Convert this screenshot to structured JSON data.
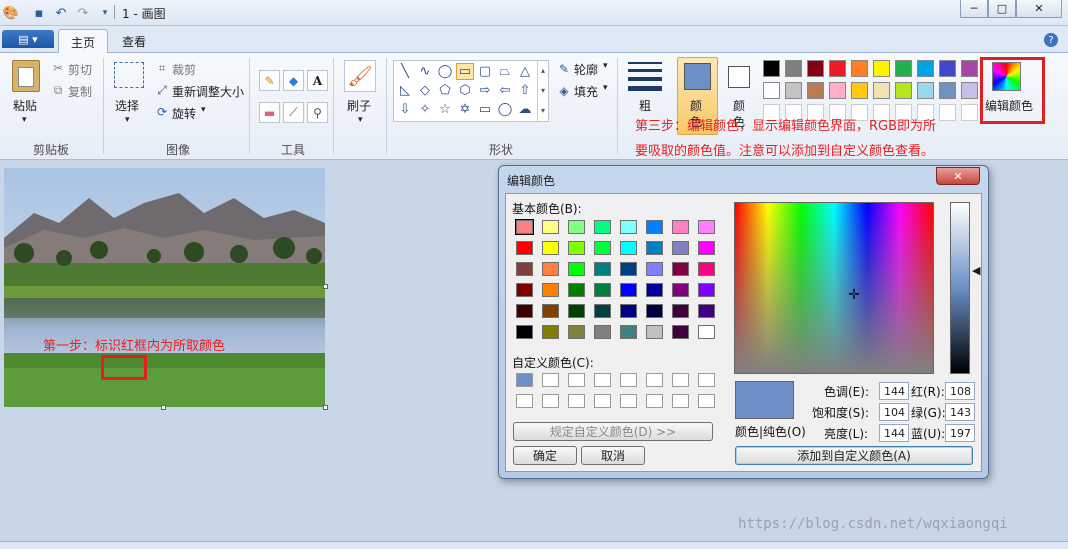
{
  "window": {
    "title": "1 - 画图",
    "min": "─",
    "max": "□",
    "close": "✕"
  },
  "tabs": {
    "file": "▤ ▾",
    "home": "主页",
    "view": "查看",
    "help": "?"
  },
  "clipboard": {
    "paste": "粘贴",
    "cut": "剪切",
    "copy": "复制",
    "label": "剪贴板"
  },
  "image_group": {
    "select": "选择",
    "crop": "裁剪",
    "resize": "重新调整大小",
    "rotate": "旋转",
    "label": "图像"
  },
  "tools_group": {
    "label": "工具",
    "brush": "刷子"
  },
  "shapes_group": {
    "outline": "轮廓",
    "fill": "填充",
    "label": "形状"
  },
  "size_label": "粗",
  "color1_label": "颜",
  "color1_label2": "色",
  "color2_label": "颜",
  "color2_label2": "色",
  "edit_colors_label": "编辑颜色",
  "palette": [
    "#000000",
    "#7f7f7f",
    "#880015",
    "#ed1c24",
    "#ff7f27",
    "#fff200",
    "#22b14c",
    "#00a2e8",
    "#3f48cc",
    "#a349a4",
    "#ffffff",
    "#c3c3c3",
    "#b97a57",
    "#ffaec9",
    "#ffc90e",
    "#efe4b0",
    "#b5e61d",
    "#99d9ea",
    "#7092be",
    "#c8bfe7"
  ],
  "annotations": {
    "step1": "第一步：标识红框内为所取颜色",
    "step3_line1": "第三步：编辑颜色，显示编辑颜色界面，RGB即为所",
    "step3_line2": "要吸取的颜色值。注意可以添加到自定义颜色查看。"
  },
  "dialog": {
    "title": "编辑颜色",
    "close": "✕",
    "basic_colors_label": "基本颜色(B):",
    "custom_colors_label": "自定义颜色(C):",
    "define_custom_button": "规定自定义颜色(D) >>",
    "ok_button": "确定",
    "cancel_button": "取消",
    "solid_label": "颜色|纯色(O)",
    "add_custom_button": "添加到自定义颜色(A)",
    "hue_label": "色调(E):",
    "hue": "144",
    "sat_label": "饱和度(S):",
    "sat": "104",
    "lum_label": "亮度(L):",
    "lum": "144",
    "red_label": "红(R):",
    "red": "108",
    "green_label": "绿(G):",
    "green": "143",
    "blue_label": "蓝(U):",
    "blue": "197",
    "current_color": "#6c8fc5",
    "basic_colors": [
      "#ff8080",
      "#ffff80",
      "#80ff80",
      "#00ff80",
      "#80ffff",
      "#0080ff",
      "#ff80c0",
      "#ff80ff",
      "#ff0000",
      "#ffff00",
      "#80ff00",
      "#00ff40",
      "#00ffff",
      "#0080c0",
      "#8080c0",
      "#ff00ff",
      "#804040",
      "#ff8040",
      "#00ff00",
      "#008080",
      "#004080",
      "#8080ff",
      "#800040",
      "#ff0080",
      "#800000",
      "#ff8000",
      "#008000",
      "#008040",
      "#0000ff",
      "#0000a0",
      "#800080",
      "#8000ff",
      "#400000",
      "#804000",
      "#004000",
      "#004040",
      "#000080",
      "#000040",
      "#400040",
      "#400080",
      "#000000",
      "#808000",
      "#808040",
      "#808080",
      "#408080",
      "#c0c0c0",
      "#400040",
      "#ffffff"
    ],
    "custom_colors": [
      "#6c8fc5",
      "#ffffff",
      "#ffffff",
      "#ffffff",
      "#ffffff",
      "#ffffff",
      "#ffffff",
      "#ffffff",
      "#ffffff",
      "#ffffff",
      "#ffffff",
      "#ffffff",
      "#ffffff",
      "#ffffff",
      "#ffffff",
      "#ffffff"
    ]
  },
  "watermark": "https://blog.csdn.net/wqxiaongqi"
}
